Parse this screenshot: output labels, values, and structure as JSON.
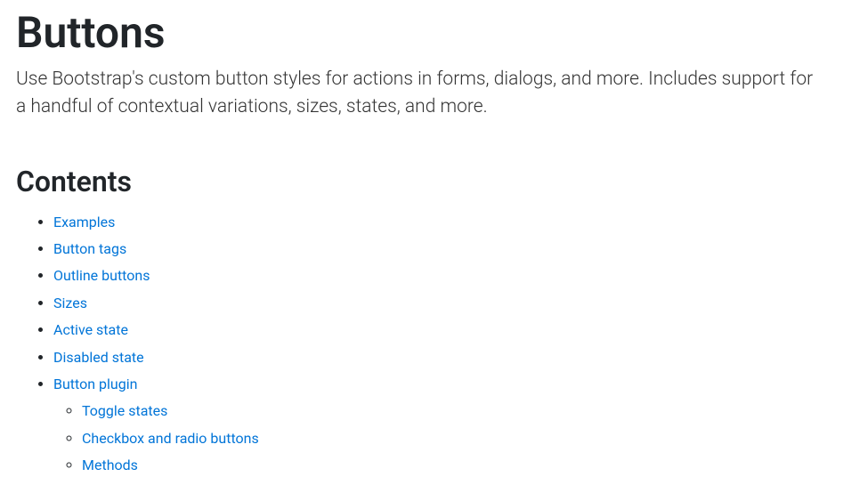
{
  "page": {
    "title": "Buttons",
    "lead": "Use Bootstrap's custom button styles for actions in forms, dialogs, and more. Includes support for a handful of contextual variations, sizes, states, and more."
  },
  "contents": {
    "heading": "Contents",
    "items": [
      {
        "label": "Examples"
      },
      {
        "label": "Button tags"
      },
      {
        "label": "Outline buttons"
      },
      {
        "label": "Sizes"
      },
      {
        "label": "Active state"
      },
      {
        "label": "Disabled state"
      },
      {
        "label": "Button plugin",
        "children": [
          {
            "label": "Toggle states"
          },
          {
            "label": "Checkbox and radio buttons"
          },
          {
            "label": "Methods"
          }
        ]
      }
    ]
  }
}
